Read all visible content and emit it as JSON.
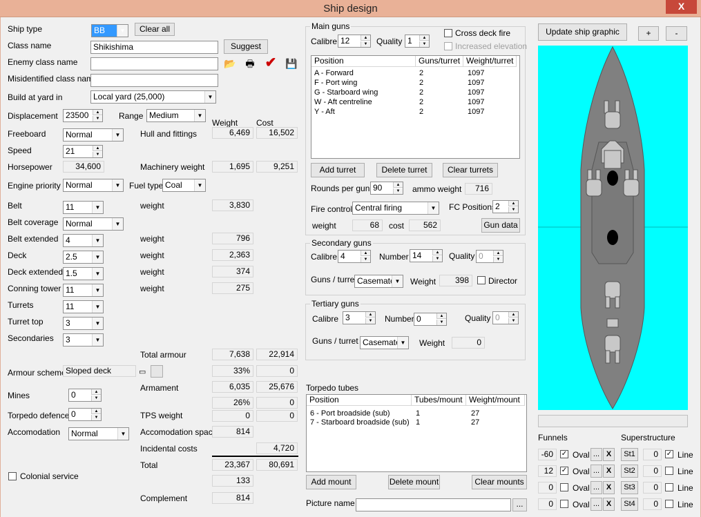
{
  "title": "Ship design",
  "close": "X",
  "left": {
    "ship_type": {
      "label": "Ship type",
      "value": "BB"
    },
    "clear_all": "Clear all",
    "class_name": {
      "label": "Class name",
      "value": "Shikishima"
    },
    "suggest": "Suggest",
    "enemy_class": {
      "label": "Enemy class name",
      "value": ""
    },
    "misidentified": {
      "label": "Misidentified class name",
      "value": ""
    },
    "build_yard": {
      "label": "Build at yard in",
      "value": "Local yard (25,000)"
    },
    "displacement": {
      "label": "Displacement",
      "value": "23500"
    },
    "range": {
      "label": "Range",
      "value": "Medium"
    },
    "col_weight": "Weight",
    "col_cost": "Cost",
    "freeboard": {
      "label": "Freeboard",
      "value": "Normal"
    },
    "hull": {
      "label": "Hull and fittings",
      "weight": "6,469",
      "cost": "16,502"
    },
    "speed": {
      "label": "Speed",
      "value": "21"
    },
    "horsepower": {
      "label": "Horsepower",
      "value": "34,600"
    },
    "machinery": {
      "label": "Machinery weight",
      "weight": "1,695",
      "cost": "9,251"
    },
    "engine_priority": {
      "label": "Engine priority",
      "value": "Normal"
    },
    "fuel_type": {
      "label": "Fuel type",
      "value": "Coal"
    },
    "belt": {
      "label": "Belt",
      "value": "11",
      "w_label": "weight",
      "weight": "3,830"
    },
    "belt_coverage": {
      "label": "Belt coverage",
      "value": "Normal"
    },
    "belt_extended": {
      "label": "Belt extended",
      "value": "4",
      "w_label": "weight",
      "weight": "796"
    },
    "deck": {
      "label": "Deck",
      "value": "2.5",
      "w_label": "weight",
      "weight": "2,363"
    },
    "deck_extended": {
      "label": "Deck extended",
      "value": "1.5",
      "w_label": "weight",
      "weight": "374"
    },
    "conning_tower": {
      "label": "Conning tower",
      "value": "11",
      "w_label": "weight",
      "weight": "275"
    },
    "turrets": {
      "label": "Turrets",
      "value": "11"
    },
    "turret_top": {
      "label": "Turret top",
      "value": "3"
    },
    "secondaries": {
      "label": "Secondaries",
      "value": "3"
    },
    "total_armour": {
      "label": "Total armour",
      "weight": "7,638",
      "cost": "22,914"
    },
    "armour_scheme": {
      "label": "Armour scheme",
      "value": "Sloped deck",
      "pct": "33%",
      "pct_cost": "0"
    },
    "armament": {
      "label": "Armament",
      "weight": "6,035",
      "cost": "25,676",
      "pct": "26%",
      "pct_cost": "0"
    },
    "mines": {
      "label": "Mines",
      "value": "0"
    },
    "torpedo_defence": {
      "label": "Torpedo defence",
      "value": "0"
    },
    "tps": {
      "label": "TPS weight",
      "weight": "0",
      "cost": "0"
    },
    "accomodation": {
      "label": "Accomodation",
      "value": "Normal"
    },
    "acc_space": {
      "label": "Accomodation space",
      "value": "814"
    },
    "incidental": {
      "label": "Incidental costs",
      "value": "4,720"
    },
    "total": {
      "label": "Total",
      "weight": "23,367",
      "cost": "80,691",
      "extra": "133"
    },
    "colonial": "Colonial service",
    "complement": {
      "label": "Complement",
      "value": "814"
    }
  },
  "main_guns": {
    "title": "Main guns",
    "calibre_label": "Calibre",
    "calibre": "12",
    "quality_label": "Quality",
    "quality": "1",
    "cross_deck": "Cross deck fire",
    "increased_elev": "Increased elevation",
    "headers": [
      "Position",
      "Guns/turret",
      "Weight/turret"
    ],
    "rows": [
      [
        "A - Forward",
        "2",
        "1097"
      ],
      [
        "F - Port wing",
        "2",
        "1097"
      ],
      [
        "G - Starboard wing",
        "2",
        "1097"
      ],
      [
        "W - Aft centreline",
        "2",
        "1097"
      ],
      [
        "Y - Aft",
        "2",
        "1097"
      ]
    ],
    "add": "Add turret",
    "delete": "Delete turret",
    "clear": "Clear turrets",
    "rounds_label": "Rounds per gun",
    "rounds": "90",
    "ammo_label": "ammo weight",
    "ammo": "716",
    "fire_label": "Fire control",
    "fire": "Central firing",
    "fc_label": "FC Positions",
    "fc": "2",
    "w_label": "weight",
    "weight": "68",
    "c_label": "cost",
    "cost": "562",
    "gun_data": "Gun data"
  },
  "secondary": {
    "title": "Secondary guns",
    "calibre_label": "Calibre",
    "calibre": "4",
    "number_label": "Number",
    "number": "14",
    "quality_label": "Quality",
    "quality": "0",
    "gpt_label": "Guns / turret",
    "gpt": "Casemate:",
    "w_label": "Weight",
    "weight": "398",
    "director": "Director"
  },
  "tertiary": {
    "title": "Tertiary guns",
    "calibre_label": "Calibre",
    "calibre": "3",
    "number_label": "Number",
    "number": "0",
    "quality_label": "Quality",
    "quality": "0",
    "gpt_label": "Guns / turret",
    "gpt": "Casemate:",
    "w_label": "Weight",
    "weight": "0"
  },
  "torpedo": {
    "title": "Torpedo tubes",
    "headers": [
      "Position",
      "Tubes/mount",
      "Weight/mount"
    ],
    "rows": [
      [
        "6 - Port broadside (sub)",
        "1",
        "27"
      ],
      [
        "7 - Starboard broadside (sub)",
        "1",
        "27"
      ]
    ],
    "add": "Add mount",
    "delete": "Delete mount",
    "clear": "Clear mounts"
  },
  "picture": {
    "label": "Picture name",
    "value": "",
    "browse": "..."
  },
  "right": {
    "update": "Update ship graphic",
    "plus": "+",
    "minus": "-",
    "funnels_label": "Funnels",
    "super_label": "Superstructure",
    "funnels": [
      {
        "v": "-60",
        "chk": "✓"
      },
      {
        "v": "12",
        "chk": "✓"
      },
      {
        "v": "0",
        "chk": ""
      },
      {
        "v": "0",
        "chk": ""
      }
    ],
    "oval": "Oval",
    "dots": "...",
    "x": "X",
    "super": [
      {
        "b": "St1",
        "v": "0",
        "chk": "✓"
      },
      {
        "b": "St2",
        "v": "0",
        "chk": ""
      },
      {
        "b": "St3",
        "v": "0",
        "chk": ""
      },
      {
        "b": "St4",
        "v": "0",
        "chk": ""
      }
    ],
    "line": "Line"
  },
  "colors": {
    "titlebar": "#e9b197",
    "close": "#c7483a",
    "sea": "#00ffff",
    "hull": "#808080",
    "accent_check": "#cc0000"
  }
}
